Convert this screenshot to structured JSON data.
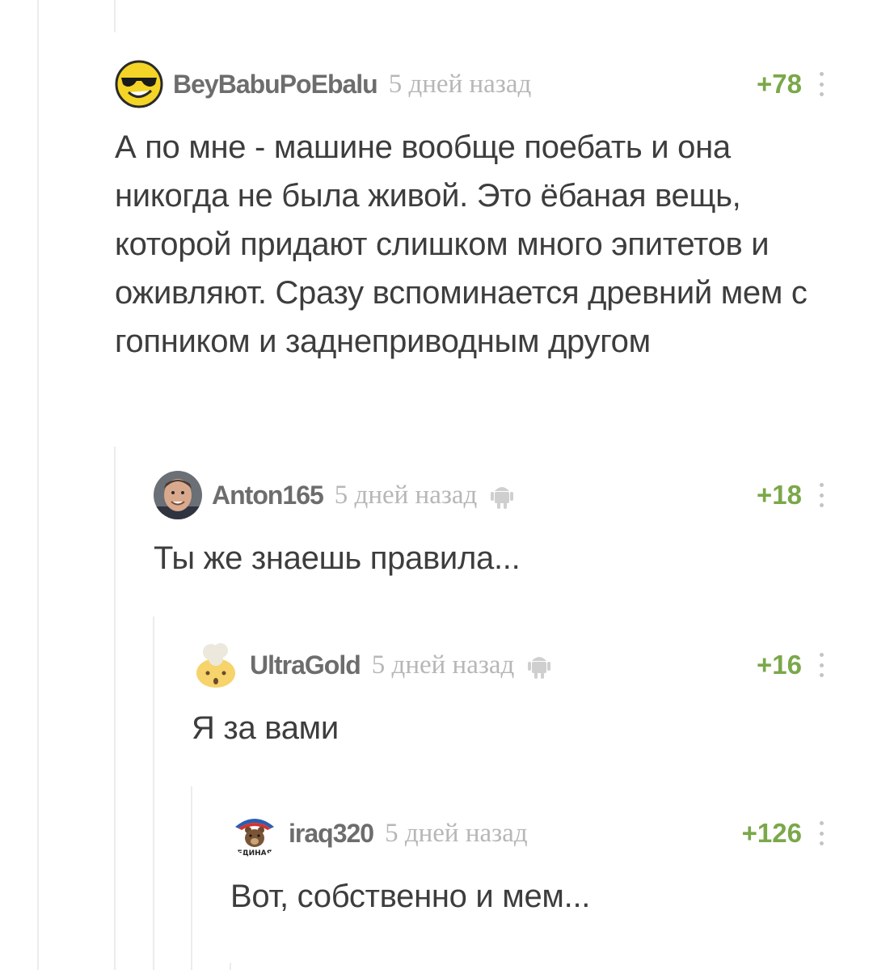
{
  "comments": [
    {
      "author": "BeyBabuPoEbalu",
      "time": "5 дней назад",
      "rating": "+78",
      "text": "А по мне - машине вообще поебать и она никогда не была живой. Это ёбаная вещь, которой придают слишком много эпитетов и оживляют. Сразу вспоминается древний мем с гопником и заднеприводным другом",
      "avatar_icon": "sunglasses-smiley-icon",
      "has_android": false
    },
    {
      "author": "Anton165",
      "time": "5 дней назад",
      "rating": "+18",
      "text": "Ты же знаешь правила...",
      "avatar_icon": "man-photo-avatar",
      "has_android": true
    },
    {
      "author": "UltraGold",
      "time": "5 дней назад",
      "rating": "+16",
      "text": "Я за вами",
      "avatar_icon": "exploding-head-icon",
      "has_android": true
    },
    {
      "author": "iraq320",
      "time": "5 дней назад",
      "rating": "+126",
      "text": "Вот, собственно и мем...",
      "avatar_icon": "party-bear-logo-icon",
      "avatar_caption": "ЕДИНАЯ",
      "has_android": false
    }
  ],
  "colors": {
    "rating": "#7aa84a",
    "time": "#b7b7b7",
    "author": "#6d6d6d",
    "thread_line": "#ececec"
  }
}
